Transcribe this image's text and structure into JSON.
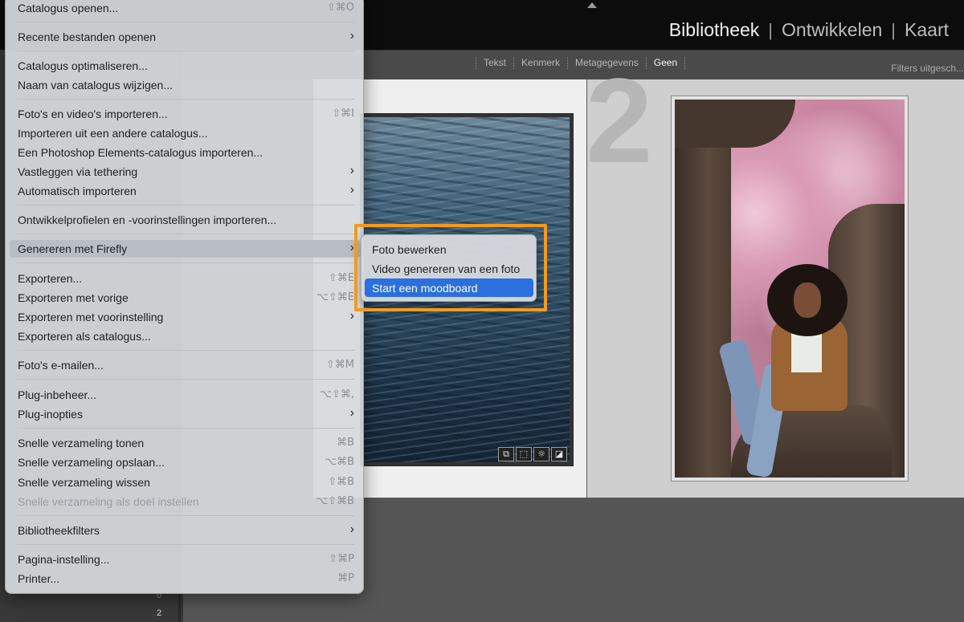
{
  "modules": {
    "library": "Bibliotheek",
    "develop": "Ontwikkelen",
    "map": "Kaart",
    "separator": "|"
  },
  "filter_bar": {
    "tabs": [
      "Tekst",
      "Kenmerk",
      "Metagegevens",
      "Geen"
    ],
    "selected": "Geen",
    "filters_off": "Filters uitgesch..."
  },
  "grid": {
    "cell_number": "2"
  },
  "left_panel": {
    "counts": [
      "0",
      "2"
    ]
  },
  "thumbnail_badges": [
    "⧉",
    "⬚",
    "☼",
    "◪"
  ],
  "menu": {
    "items": [
      {
        "label": "Catalogus openen...",
        "shortcut": "⇧⌘O"
      },
      {
        "label": "Recente bestanden openen",
        "submenu": true
      },
      {
        "label": "Catalogus optimaliseren..."
      },
      {
        "label": "Naam van catalogus wijzigen..."
      },
      {
        "label": "Foto's en video's importeren...",
        "shortcut": "⇧⌘I"
      },
      {
        "label": "Importeren uit een andere catalogus..."
      },
      {
        "label": "Een Photoshop Elements-catalogus importeren..."
      },
      {
        "label": "Vastleggen via tethering",
        "submenu": true
      },
      {
        "label": "Automatisch importeren",
        "submenu": true
      },
      {
        "label": "Ontwikkelprofielen en -voorinstellingen importeren..."
      },
      {
        "label": "Genereren met Firefly",
        "submenu": true,
        "highlighted": true
      },
      {
        "label": "Exporteren...",
        "shortcut": "⇧⌘E"
      },
      {
        "label": "Exporteren met vorige",
        "shortcut": "⌥⇧⌘E"
      },
      {
        "label": "Exporteren met voorinstelling",
        "submenu": true
      },
      {
        "label": "Exporteren als catalogus..."
      },
      {
        "label": "Foto's e-mailen...",
        "shortcut": "⇧⌘M"
      },
      {
        "label": "Plug-inbeheer...",
        "shortcut": "⌥⇧⌘,"
      },
      {
        "label": "Plug-inopties",
        "submenu": true
      },
      {
        "label": "Snelle verzameling tonen",
        "shortcut": "⌘B"
      },
      {
        "label": "Snelle verzameling opslaan...",
        "shortcut": "⌥⌘B"
      },
      {
        "label": "Snelle verzameling wissen",
        "shortcut": "⇧⌘B"
      },
      {
        "label": "Snelle verzameling als doel instellen",
        "shortcut": "⌥⇧⌘B",
        "disabled": true
      },
      {
        "label": "Bibliotheekfilters",
        "submenu": true
      },
      {
        "label": "Pagina-instelling...",
        "shortcut": "⇧⌘P"
      },
      {
        "label": "Printer...",
        "shortcut": "⌘P"
      }
    ],
    "chevron": "›"
  },
  "submenu": {
    "items": [
      {
        "label": "Foto bewerken"
      },
      {
        "label": "Video genereren van een foto"
      },
      {
        "label": "Start een moodboard",
        "selected": true
      }
    ]
  },
  "colors": {
    "callout": "#f39a1e",
    "selection": "#2c6fde"
  }
}
